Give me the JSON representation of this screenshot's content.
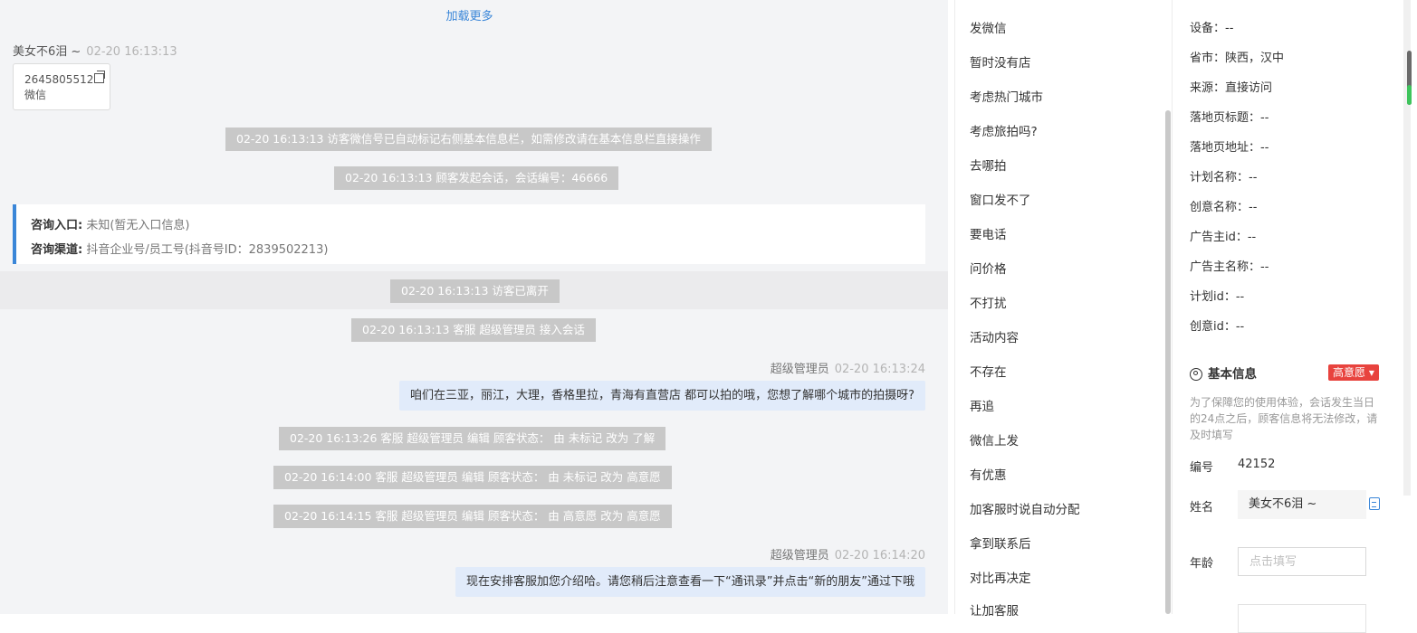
{
  "chat": {
    "load_more": "加载更多",
    "visitor_name": "美女不6泪 ~",
    "visitor_time": "02-20 16:13:13",
    "wechat_card": {
      "id": "2645805512",
      "label": "微信"
    },
    "system_messages": [
      "02-20 16:13:13 访客微信号已自动标记右侧基本信息栏，如需修改请在基本信息栏直接操作",
      "02-20 16:13:13 顾客发起会话，会话编号：46666",
      "02-20 16:13:13 访客已离开",
      "02-20 16:13:13 客服 超级管理员 接入会话",
      "02-20 16:13:26 客服 超级管理员 编辑 顾客状态： 由 未标记 改为 了解",
      "02-20 16:14:00 客服 超级管理员 编辑 顾客状态： 由 未标记 改为 高意愿",
      "02-20 16:14:15 客服 超级管理员 编辑 顾客状态： 由 高意愿 改为 高意愿"
    ],
    "consult": {
      "entry_label": "咨询入口:",
      "entry_value": "未知(暂无入口信息)",
      "channel_label": "咨询渠道:",
      "channel_value": "抖音企业号/员工号(抖音号ID：2839502213)"
    },
    "agent_messages": [
      {
        "name": "超级管理员",
        "time": "02-20 16:13:24",
        "text": "咱们在三亚，丽江，大理，香格里拉，青海有直营店 都可以拍的哦，您想了解哪个城市的拍摄呀?"
      },
      {
        "name": "超级管理员",
        "time": "02-20 16:14:20",
        "text": "现在安排客服加您介绍哈。请您稍后注意查看一下“通讯录”并点击“新的朋友”通过下哦"
      }
    ]
  },
  "quick_replies": [
    "发微信",
    "暂时没有店",
    "考虑热门城市",
    "考虑旅拍吗?",
    "去哪拍",
    "窗口发不了",
    "要电话",
    "问价格",
    "不打扰",
    "活动内容",
    "不存在",
    "再追",
    "微信上发",
    "有优惠",
    "加客服时说自动分配",
    "拿到联系后",
    "对比再决定",
    "让加客服"
  ],
  "info": {
    "rows": [
      "设备：--",
      "省市：陕西，汉中",
      "来源：直接访问",
      "落地页标题：--",
      "落地页地址：--",
      "计划名称：--",
      "创意名称：--",
      "广告主id：--",
      "广告主名称：--",
      "计划id：--",
      "创意id：--"
    ],
    "section_title": "基本信息",
    "intent_badge": "高意愿 ▾",
    "tip": "为了保障您的使用体验，会话发生当日的24点之后，顾客信息将无法修改，请及时填写",
    "id_label": "编号",
    "id_value": "42152",
    "name_label": "姓名",
    "name_value": "美女不6泪 ~",
    "age_label": "年龄",
    "age_placeholder": "点击填写"
  }
}
